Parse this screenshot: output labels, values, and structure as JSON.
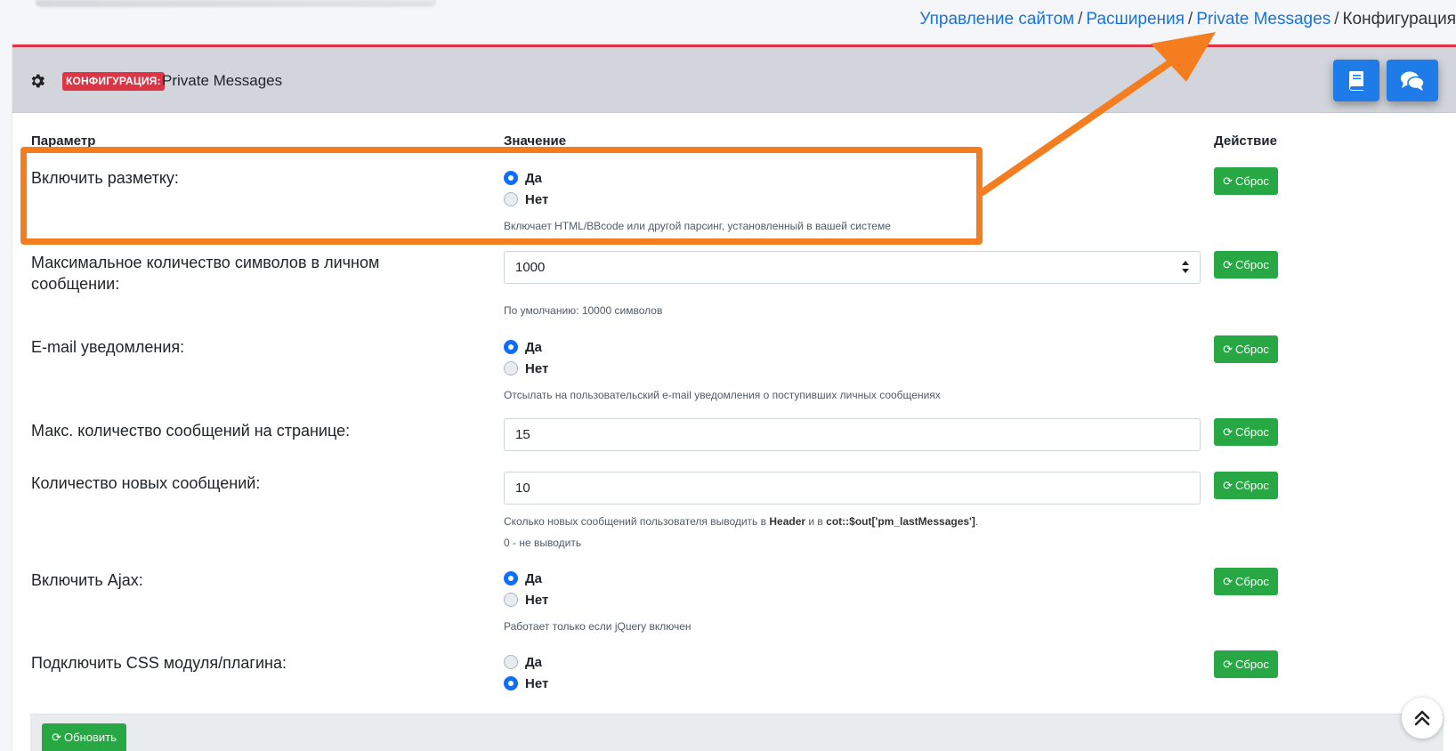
{
  "breadcrumb": {
    "items": [
      "Управление сайтом",
      "Расширения",
      "Private Messages"
    ],
    "current": "Конфигурация",
    "separator": "/"
  },
  "header": {
    "badge": "КОНФИГУРАЦИЯ:",
    "title": "Private Messages",
    "icons": [
      "gear-icon",
      "book-icon",
      "comments-icon"
    ]
  },
  "table": {
    "col_param": "Параметр",
    "col_value": "Значение",
    "col_action": "Действие"
  },
  "options": {
    "yes": "Да",
    "no": "Нет"
  },
  "reset_label": "Сброс",
  "rows": {
    "markup": {
      "label": "Включить разметку:",
      "selected": "Да",
      "hint": "Включает HTML/BBcode или другой парсинг, установленный в вашей системе"
    },
    "maxchars": {
      "label": "Максимальное количество символов в личном сообщении:",
      "value": "1000",
      "hint": "По умолчанию: 10000 символов"
    },
    "email": {
      "label": "E-mail уведомления:",
      "selected": "Да",
      "hint": "Отсылать на пользовательский e-mail уведомления о поступивших личных сообщениях"
    },
    "perpage": {
      "label": "Макс. количество сообщений на странице:",
      "value": "15"
    },
    "newmsgs": {
      "label": "Количество новых сообщений:",
      "value": "10",
      "hint_prefix": "Сколько новых сообщений пользователя выводить в",
      "hint_b1": "Header",
      "hint_mid": "и в",
      "hint_b2": "cot::$out['pm_lastMessages']",
      "hint_suffix": ".",
      "hint2": "0 - не выводить"
    },
    "ajax": {
      "label": "Включить Ajax:",
      "selected": "Да",
      "hint": "Работает только если jQuery включен"
    },
    "css": {
      "label": "Подключить CSS модуля/плагина:",
      "selected": "Нет"
    }
  },
  "footer": {
    "update_label": "Обновить"
  },
  "colors": {
    "accent_red": "#dc3545",
    "link_blue": "#1a73d9",
    "btn_blue": "#1f7be8",
    "btn_green": "#28a745",
    "annotation_orange": "#f47d20"
  }
}
